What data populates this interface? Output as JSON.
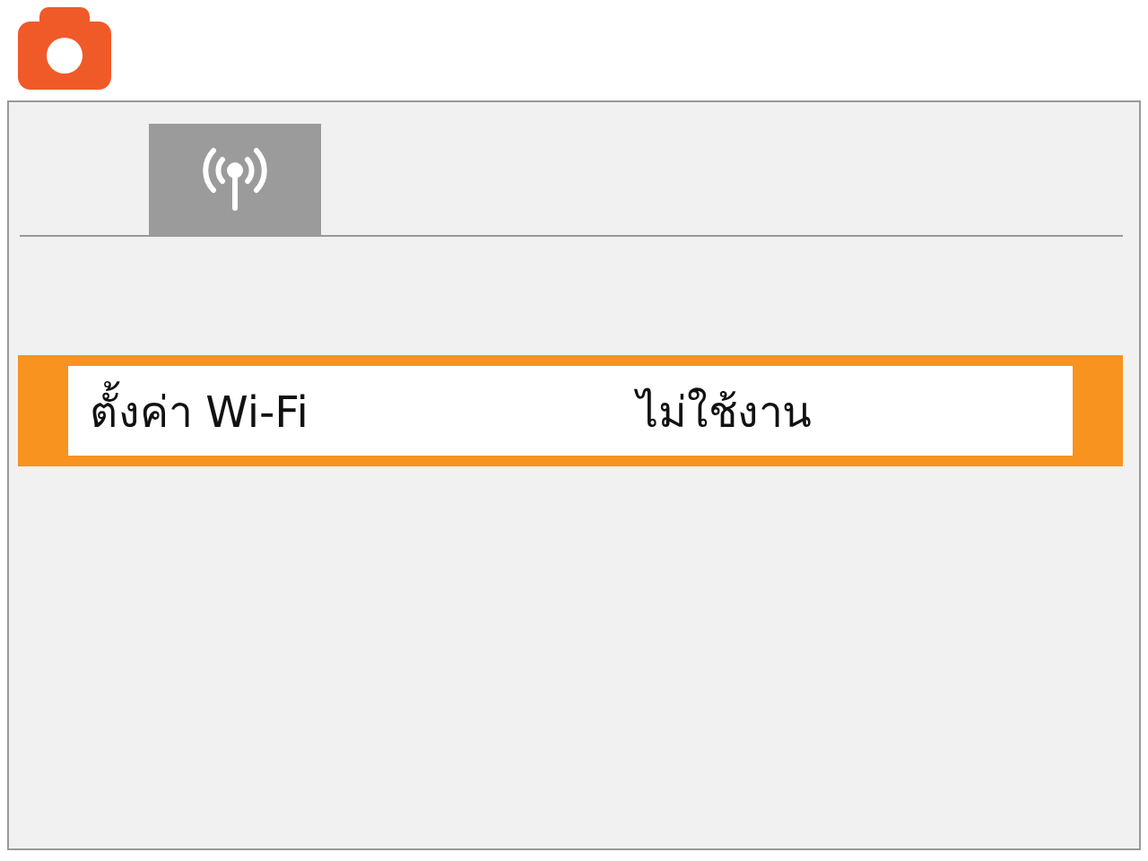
{
  "header": {
    "kind": "camera"
  },
  "tabs": [
    {
      "kind": "wifi",
      "selected": true
    }
  ],
  "menu": {
    "items": [
      {
        "label": "ตั้งค่า Wi-Fi",
        "value": "ไม่ใช้งาน",
        "selected": true
      }
    ]
  }
}
